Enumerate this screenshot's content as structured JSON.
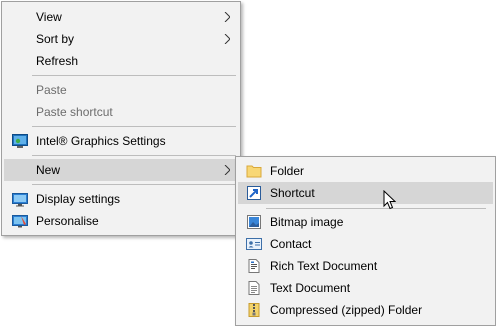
{
  "context_menu": {
    "items": [
      {
        "label": "View"
      },
      {
        "label": "Sort by"
      },
      {
        "label": "Refresh"
      },
      {
        "label": "Paste"
      },
      {
        "label": "Paste shortcut"
      },
      {
        "label": "Intel® Graphics Settings"
      },
      {
        "label": "New"
      },
      {
        "label": "Display settings"
      },
      {
        "label": "Personalise"
      }
    ]
  },
  "new_submenu": {
    "items": [
      {
        "label": "Folder"
      },
      {
        "label": "Shortcut"
      },
      {
        "label": "Bitmap image"
      },
      {
        "label": "Contact"
      },
      {
        "label": "Rich Text Document"
      },
      {
        "label": "Text Document"
      },
      {
        "label": "Compressed (zipped) Folder"
      }
    ]
  }
}
